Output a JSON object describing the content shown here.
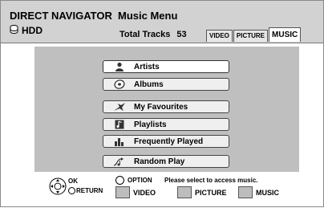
{
  "header": {
    "app_title": "DIRECT NAVIGATOR",
    "menu_title": "Music Menu",
    "drive": {
      "icon": "hdd-icon",
      "label": "HDD"
    },
    "total_tracks_label": "Total Tracks",
    "total_tracks_value": "53",
    "tabs": [
      {
        "label": "VIDEO",
        "active": false
      },
      {
        "label": "PICTURE",
        "active": false
      },
      {
        "label": "MUSIC",
        "active": true
      }
    ]
  },
  "menu": {
    "items": [
      {
        "label": "Artists",
        "icon": "person-icon",
        "selected": true
      },
      {
        "label": "Albums",
        "icon": "disc-icon",
        "selected": false
      },
      {
        "label": "My Favourites",
        "icon": "star-icon",
        "selected": false
      },
      {
        "label": "Playlists",
        "icon": "playlist-icon",
        "selected": false
      },
      {
        "label": "Frequently Played",
        "icon": "bar-chart-icon",
        "selected": false
      },
      {
        "label": "Random Play",
        "icon": "shuffle-notes-icon",
        "selected": false
      }
    ]
  },
  "footer": {
    "ok_label": "OK",
    "return_label": "RETURN",
    "option_label": "OPTION",
    "hint": "Please select to access music.",
    "color_buttons": [
      "VIDEO",
      "PICTURE",
      "MUSIC"
    ]
  }
}
